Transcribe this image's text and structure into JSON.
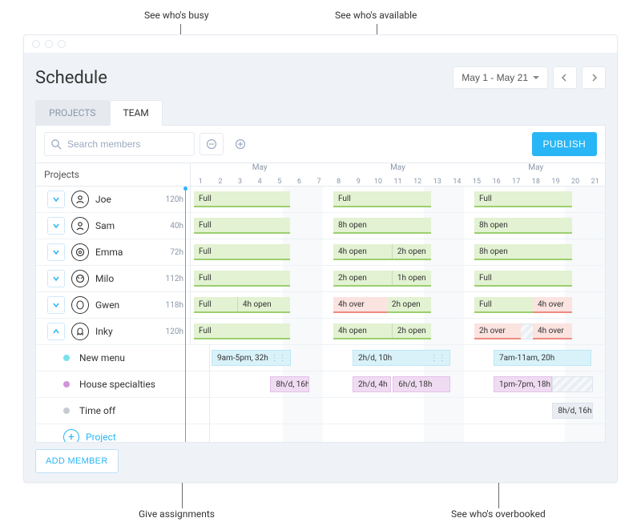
{
  "callouts": {
    "busy": "See who's busy",
    "available": "See who's available",
    "assignments": "Give assignments",
    "overbooked": "See who's overbooked"
  },
  "page_title": "Schedule",
  "date_range": "May 1 - May 21",
  "tabs": {
    "projects": "PROJECTS",
    "team": "TEAM"
  },
  "search": {
    "placeholder": "Search members",
    "value": ""
  },
  "publish_label": "PUBLISH",
  "side_header": "Projects",
  "month_label": "May",
  "days": {
    "w1": [
      "1",
      "2",
      "3",
      "4",
      "5",
      "6",
      "7"
    ],
    "w2": [
      "8",
      "9",
      "10",
      "11",
      "12",
      "13",
      "14"
    ],
    "w3": [
      "15",
      "16",
      "17",
      "18",
      "19",
      "20",
      "21"
    ]
  },
  "members": [
    {
      "name": "Joe",
      "hours": "120h",
      "expanded": false
    },
    {
      "name": "Sam",
      "hours": "40h",
      "expanded": false
    },
    {
      "name": "Emma",
      "hours": "72h",
      "expanded": false
    },
    {
      "name": "Milo",
      "hours": "112h",
      "expanded": false
    },
    {
      "name": "Gwen",
      "hours": "118h",
      "expanded": false
    },
    {
      "name": "Inky",
      "hours": "120h",
      "expanded": true
    }
  ],
  "bars": {
    "joe": {
      "w1": "Full",
      "w2": "Full",
      "w3": "Full"
    },
    "sam": {
      "w1": "Full",
      "w2": "8h open",
      "w3": "8h open"
    },
    "emma": {
      "w1": "Full",
      "w2a": "4h open",
      "w2b": "2h open",
      "w3": "8h open"
    },
    "milo": {
      "w1": "Full",
      "w2a": "2h open",
      "w2b": "1h open",
      "w3": "Full"
    },
    "gwen": {
      "w1a": "Full",
      "w1b": "4h open",
      "w2a": "4h over",
      "w2b": "2h open",
      "w3a": "Full",
      "w3b": "4h over"
    },
    "inky": {
      "w1": "Full",
      "w2a": "4h open",
      "w2b": "2h open",
      "w3a": "2h over",
      "w3b": "4h over"
    }
  },
  "tasks": {
    "new_menu_label": "New menu",
    "new_menu": {
      "w1": "9am-5pm, 32h",
      "w2": "2h/d, 10h",
      "w3": "7am-11am, 20h"
    },
    "house_label": "House specialties",
    "house": {
      "w1": "8h/d, 16h",
      "w2a": "2h/d, 4h",
      "w2b": "6h/d, 18h",
      "w3": "1pm-7pm, 18h"
    },
    "timeoff_label": "Time off",
    "timeoff": {
      "w3": "8h/d, 16h"
    },
    "add_project": "Project"
  },
  "add_member_label": "ADD MEMBER"
}
